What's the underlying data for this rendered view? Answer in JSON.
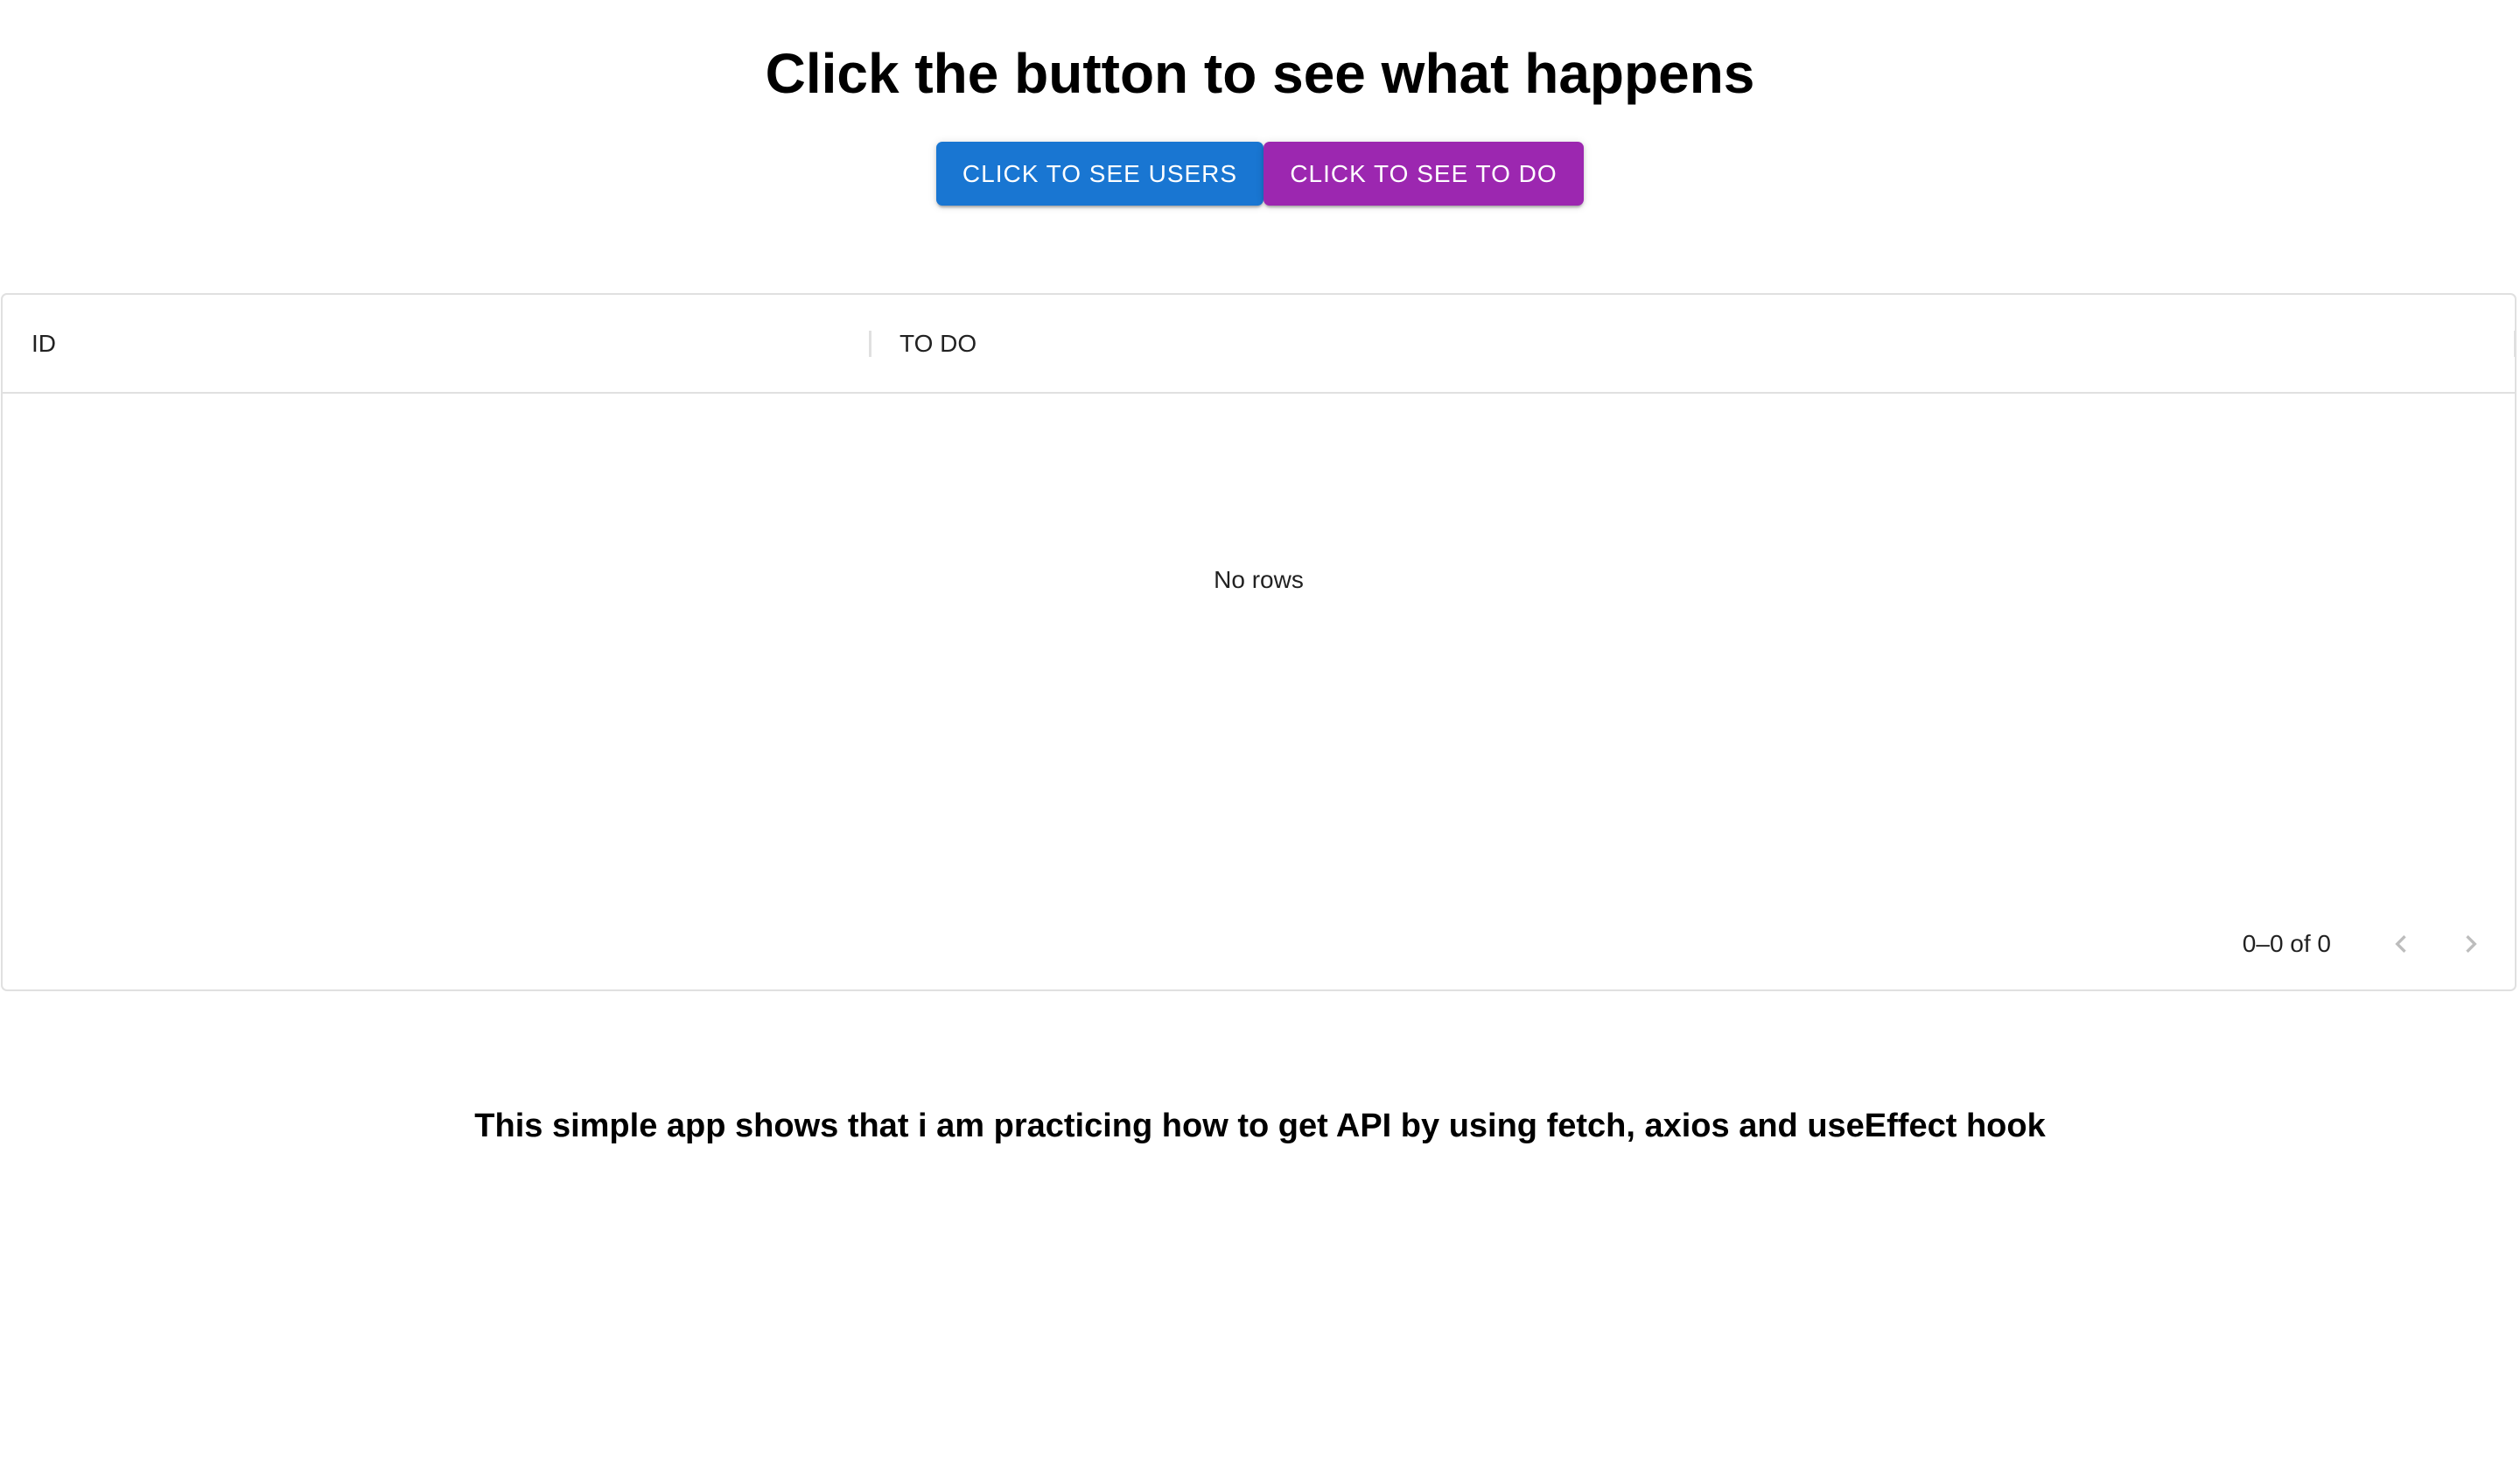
{
  "page": {
    "title": "Click the button to see what happens",
    "footer_note": "This simple app shows that i am practicing how to get API by using fetch, axios and useEffect hook"
  },
  "buttons": {
    "users_label": "CLICK TO SEE USERS",
    "todo_label": "CLICK TO SEE TO DO"
  },
  "grid": {
    "columns": [
      {
        "label": "ID"
      },
      {
        "label": "TO DO"
      }
    ],
    "empty_message": "No rows",
    "pagination_text": "0–0 of 0",
    "prev_icon": "chevron-left-icon",
    "next_icon": "chevron-right-icon"
  },
  "colors": {
    "users_button": "#1976d2",
    "todo_button": "#9c27b0",
    "border": "#e0e0e0",
    "disabled_icon": "#bdbdbd"
  }
}
